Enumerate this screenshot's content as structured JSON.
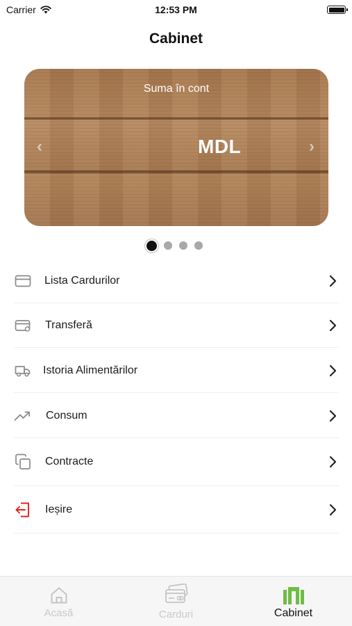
{
  "status_bar": {
    "carrier": "Carrier",
    "time": "12:53 PM"
  },
  "header": {
    "title": "Cabinet"
  },
  "balance_card": {
    "caption": "Suma în cont",
    "amount": "MDL",
    "prev_icon": "chevron-left-icon",
    "next_icon": "chevron-right-icon"
  },
  "pager": {
    "total": 4,
    "active_index": 0
  },
  "menu": {
    "items": [
      {
        "label": "Lista Cardurilor",
        "icon": "credit-card-icon"
      },
      {
        "label": "Transferă",
        "icon": "card-transfer-icon"
      },
      {
        "label": "Istoria Alimentărilor",
        "icon": "truck-icon"
      },
      {
        "label": "Consum",
        "icon": "trending-up-icon"
      },
      {
        "label": "Contracte",
        "icon": "copy-documents-icon"
      },
      {
        "label": "Ieșire",
        "icon": "logout-icon",
        "color": "#e0241b"
      }
    ]
  },
  "tabbar": {
    "tabs": [
      {
        "label": "Acasă",
        "icon": "home-icon",
        "active": false
      },
      {
        "label": "Carduri",
        "icon": "cards-icon",
        "active": false
      },
      {
        "label": "Cabinet",
        "icon": "cabinet-icon",
        "active": true
      }
    ],
    "accent": "#6ebd45"
  }
}
